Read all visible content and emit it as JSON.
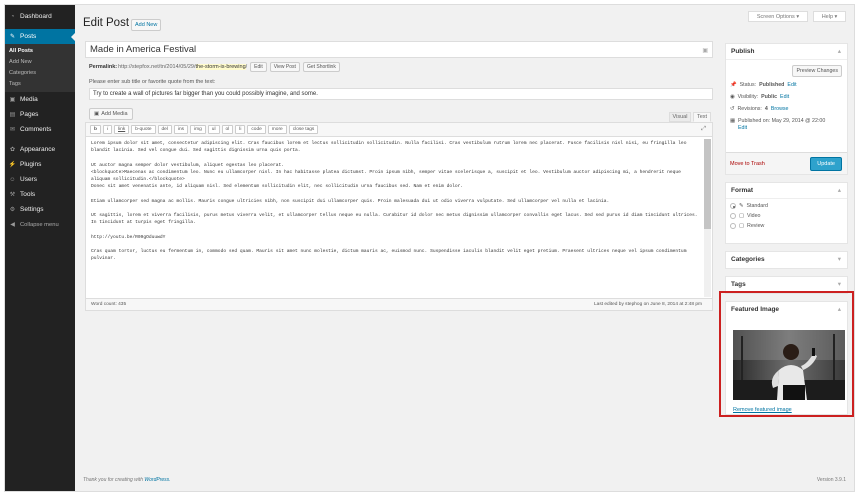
{
  "header": {
    "title": "Edit Post",
    "add_new": "Add New",
    "screen_options": "Screen Options ▾",
    "help": "Help ▾"
  },
  "sidebar": {
    "items": [
      {
        "label": "Dashboard",
        "icon": "dashboard-icon",
        "glyph": "◔"
      },
      {
        "label": "Posts",
        "icon": "pushpin-icon",
        "glyph": "✎"
      },
      {
        "label": "Media",
        "icon": "media-icon",
        "glyph": "▣"
      },
      {
        "label": "Pages",
        "icon": "pages-icon",
        "glyph": "▤"
      },
      {
        "label": "Comments",
        "icon": "comments-icon",
        "glyph": "✉"
      },
      {
        "label": "Appearance",
        "icon": "appearance-icon",
        "glyph": "✿"
      },
      {
        "label": "Plugins",
        "icon": "plugins-icon",
        "glyph": "⚡"
      },
      {
        "label": "Users",
        "icon": "users-icon",
        "glyph": "☺"
      },
      {
        "label": "Tools",
        "icon": "tools-icon",
        "glyph": "⚒"
      },
      {
        "label": "Settings",
        "icon": "settings-icon",
        "glyph": "⚙"
      },
      {
        "label": "Collapse menu",
        "icon": "collapse-icon",
        "glyph": "◀"
      }
    ],
    "posts_sub": [
      "All Posts",
      "Add New",
      "Categories",
      "Tags"
    ]
  },
  "post": {
    "title": "Made in America Festival",
    "permalink_label": "Permalink:",
    "permalink_base": "http://stepfox.net/tn/2014/05/29/",
    "permalink_slug": "the-storm-is-brewing",
    "permalink_end": "/",
    "permalink_buttons": [
      "Edit",
      "View Post",
      "Get Shortlink"
    ],
    "subtitle_label": "Please enter sub title or favorite quote from the text:",
    "subtitle_value": "Try to create a wall of pictures far bigger than you could possibly imagine, and some.",
    "add_media": "Add Media"
  },
  "editor": {
    "tabs": [
      "Visual",
      "Text"
    ],
    "quicktags": [
      "b",
      "i",
      "link",
      "b-quote",
      "del",
      "ins",
      "img",
      "ul",
      "ol",
      "li",
      "code",
      "more",
      "close tags"
    ],
    "paragraphs": [
      "Lorem ipsum dolor sit amet, consectetur adipiscing elit. Cras faucibus lorem et lectus sollicitudin sollicitudin. Nulla facilisi. Cras vestibulum rutrum lorem nec placerat. Fusce facilisis nisl nisi, eu fringilla leo blandit lacinia. Sed vel congue dui. Sed sagittis dignissim urna quis porta.",
      "Ut auctor magna semper dolor vestibulum, aliquet egestas leo placerat.\n<blockquote>Maecenas ac condimentum leo. Nunc eu ullamcorper nisl. In hac habitasse platea dictumst. Proin ipsum nibh, semper vitae scelerisque a, suscipit et leo. Vestibulum auctor adipiscing mi, a hendrerit neque aliquam sollicitudin.</blockquote>\nDonec sit amet venenatis ante, id aliquam nisl. Sed elementum sollicitudin elit, nec sollicitudin urna faucibus sed. Nam et enim dolor.",
      "Etiam ullamcorper sed magna ac mollis. Mauris congue ultricies nibh, non suscipit dui ullamcorper quis. Proin malesuada dui ut odio viverra vulputate. Sed ullamcorper vel nulla et lacinia.",
      "Ut sagittis, lorem et viverra facilisis, purus metus viverra velit, et ullamcorper tellus neque eu nulla. Curabitur id dolor nec metus dignissim ullamcorper convallis eget lacus. Sed sed purus id diam tincidunt ultrices. In tincidunt at turpis eget fringilla.",
      "http://youtu.be/R09gOduuwdY",
      "Cras quam tortor, luctus eu fermentum in, commodo sed quam. Mauris sit amet nunc molestie, dictum mauris ac, euismod nunc. Suspendisse iaculis blandit velit eget pretium. Praesent ultrices neque vel ipsum condimentum pulvinar."
    ],
    "word_count": "Word count: 435",
    "last_edited": "Last edited by stephog on June 8, 2014 at 2:48 pm"
  },
  "publish": {
    "title": "Publish",
    "preview": "Preview Changes",
    "status_label": "Status:",
    "status_value": "Published",
    "status_link": "Edit",
    "visibility_label": "Visibility:",
    "visibility_value": "Public",
    "visibility_link": "Edit",
    "revisions_label": "Revisions:",
    "revisions_count": "4",
    "revisions_link": "Browse",
    "published_on": "Published on: May 29, 2014 @ 22:00",
    "published_link": "Edit",
    "trash": "Move to Trash",
    "update": "Update"
  },
  "format": {
    "title": "Format",
    "options": [
      "Standard",
      "Video",
      "Review"
    ],
    "selected": "Standard"
  },
  "categories": {
    "title": "Categories"
  },
  "tags": {
    "title": "Tags"
  },
  "featured": {
    "title": "Featured Image",
    "remove": "Remove featured image"
  },
  "footer": {
    "thanks": "Thank you for creating with ",
    "wp": "WordPress.",
    "version": "Version 3.9.1"
  },
  "colors": {
    "accent": "#0074a2",
    "highlight": "#cc2020",
    "sidebar": "#222222"
  }
}
